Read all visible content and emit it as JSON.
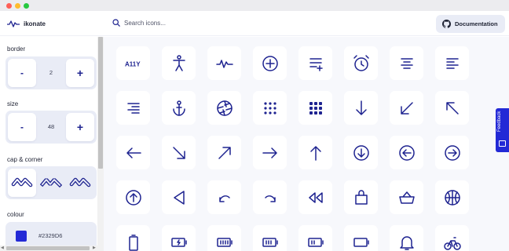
{
  "app": {
    "name": "ikonate"
  },
  "search": {
    "placeholder": "Search icons..."
  },
  "header": {
    "documentation_label": "Documentation"
  },
  "sidebar": {
    "border": {
      "label": "border",
      "value": "2",
      "minus": "-",
      "plus": "+"
    },
    "size": {
      "label": "size",
      "value": "48",
      "minus": "-",
      "plus": "+"
    },
    "cap_corner": {
      "label": "cap & corner",
      "options": [
        "round",
        "square",
        "miter"
      ],
      "selected": "round"
    },
    "color": {
      "label": "colour",
      "value": "#2329D6"
    }
  },
  "feedback": {
    "label": "Feedback"
  },
  "icons": [
    "a11y-icon",
    "accessibility-icon",
    "activity-icon",
    "add-icon",
    "add-to-list-icon",
    "alarm-icon",
    "align-center-icon",
    "align-left-icon",
    "align-right-icon",
    "anchor-icon",
    "aperture-icon",
    "apps-icon",
    "apps-alt-icon",
    "arrow-down-icon",
    "arrow-down-left-icon",
    "arrow-up-left-icon",
    "arrow-left-icon",
    "arrow-down-right-icon",
    "arrow-up-right-icon",
    "arrow-right-icon",
    "arrow-up-icon",
    "arrow-down-circle-icon",
    "arrow-left-circle-icon",
    "arrow-right-circle-icon",
    "arrow-up-circle-icon",
    "back-icon",
    "undo-icon",
    "redo-icon",
    "rewind-icon",
    "bag-icon",
    "basket-icon",
    "basketball-icon",
    "battery-icon",
    "battery-charging-icon",
    "battery-full-icon",
    "battery-medium-icon",
    "battery-low-icon",
    "battery-empty-icon",
    "bell-icon",
    "bike-icon"
  ],
  "colors": {
    "accent": "#2329D6",
    "icon_stroke": "#1E2390",
    "panel_bg": "#E9ECF6",
    "grid_bg": "#F7F8FC"
  }
}
